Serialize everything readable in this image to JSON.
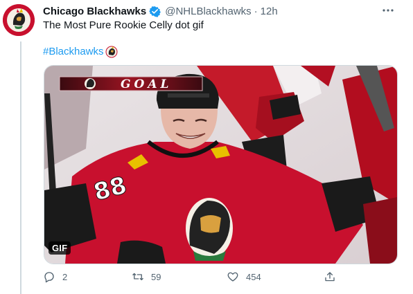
{
  "tweet": {
    "author_name": "Chicago Blackhawks",
    "handle": "@NHLBlackhawks",
    "separator": "·",
    "time": "12h",
    "text": "The Most Pure Rookie Celly dot gif",
    "hashtag": "#Blackhawks"
  },
  "media": {
    "type": "gif",
    "badge": "GIF",
    "overlay_text": "GOAL"
  },
  "actions": {
    "replies": "2",
    "retweets": "59",
    "likes": "454"
  },
  "icons": {
    "avatar": "blackhawks-logo",
    "verified": "verified-badge-icon",
    "more": "more-options-icon",
    "reply": "reply-icon",
    "retweet": "retweet-icon",
    "like": "heart-icon",
    "share": "share-icon"
  },
  "colors": {
    "accent": "#1d9bf0",
    "secondary_text": "#536471",
    "team_red": "#c8102e"
  }
}
